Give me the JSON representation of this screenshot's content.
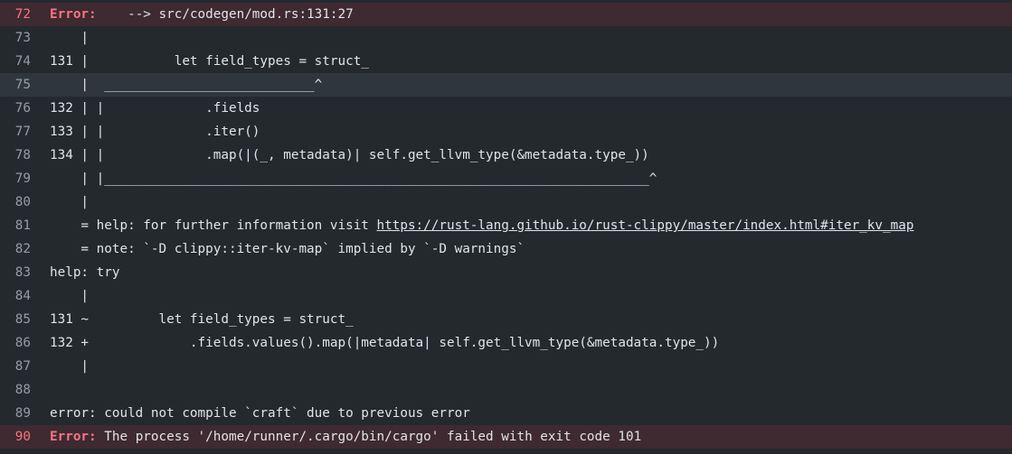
{
  "lines": [
    {
      "n": "72",
      "tag": "Error:",
      "text": "    --> src/codegen/mod.rs:131:27"
    },
    {
      "n": "73",
      "text": "    |"
    },
    {
      "n": "74",
      "text": "131 |           let field_types = struct_"
    },
    {
      "n": "75",
      "text": "    |  ___________________________^"
    },
    {
      "n": "76",
      "text": "132 | |             .fields"
    },
    {
      "n": "77",
      "text": "133 | |             .iter()"
    },
    {
      "n": "78",
      "text": "134 | |             .map(|(_, metadata)| self.get_llvm_type(&metadata.type_))"
    },
    {
      "n": "79",
      "text": "    | |______________________________________________________________________^"
    },
    {
      "n": "80",
      "text": "    |"
    },
    {
      "n": "81",
      "text": "    = help: for further information visit ",
      "link": "https://rust-lang.github.io/rust-clippy/master/index.html#iter_kv_map"
    },
    {
      "n": "82",
      "text": "    = note: `-D clippy::iter-kv-map` implied by `-D warnings`"
    },
    {
      "n": "83",
      "text": "help: try"
    },
    {
      "n": "84",
      "text": "    |"
    },
    {
      "n": "85",
      "text": "131 ~         let field_types = struct_"
    },
    {
      "n": "86",
      "text": "132 +             .fields.values().map(|metadata| self.get_llvm_type(&metadata.type_))"
    },
    {
      "n": "87",
      "text": "    |"
    },
    {
      "n": "88",
      "text": ""
    },
    {
      "n": "89",
      "text": "error: could not compile `craft` due to previous error"
    },
    {
      "n": "90",
      "tag": "Error:",
      "text": " The process '/home/runner/.cargo/bin/cargo' failed with exit code 101"
    }
  ],
  "colors": {
    "background": "#24292e",
    "error_row": "#3e2a30",
    "error_text": "#f97583",
    "highlight_row": "#2f363d",
    "line_number": "#959da5"
  }
}
